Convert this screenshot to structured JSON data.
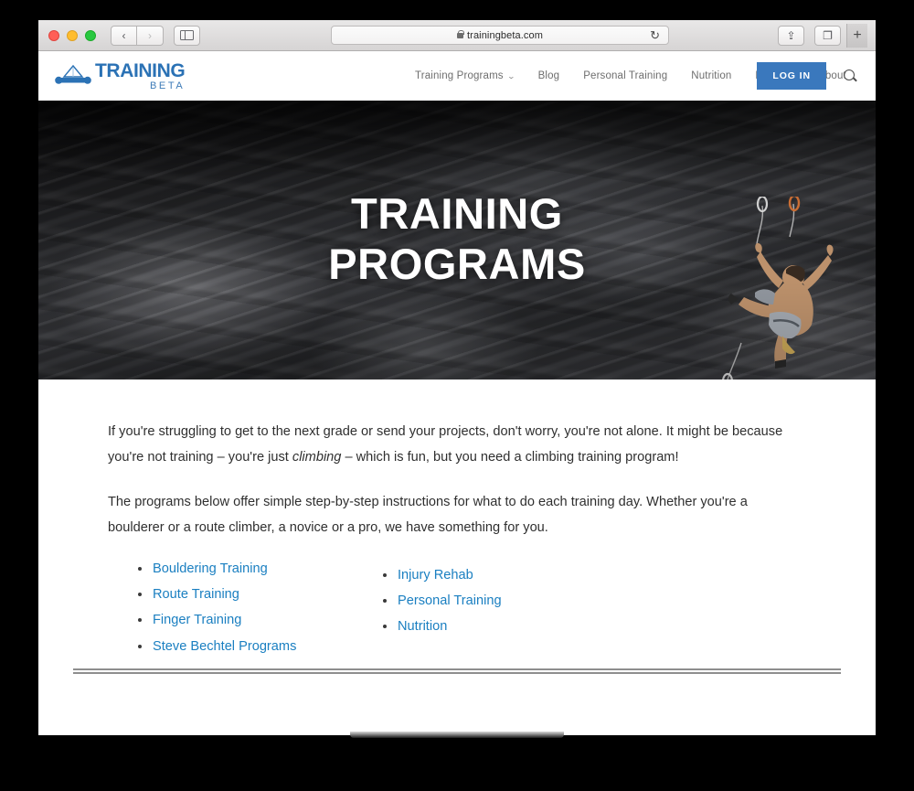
{
  "browser": {
    "url": "trainingbeta.com",
    "lock_icon": "lock-icon",
    "reload_icon": "↻",
    "back_icon": "‹",
    "forward_icon": "›",
    "sidebar_icon": "sidebar-icon",
    "share_icon": "⇪",
    "tabs_icon": "❐",
    "new_tab_icon": "+"
  },
  "site_header": {
    "logo": {
      "primary": "TRAINING",
      "secondary": "BETA",
      "mark": "climber-mountain-icon"
    },
    "nav": [
      {
        "label": "Training Programs",
        "has_dropdown": true,
        "caret": "⌄"
      },
      {
        "label": "Blog",
        "has_dropdown": false
      },
      {
        "label": "Personal Training",
        "has_dropdown": false
      },
      {
        "label": "Nutrition",
        "has_dropdown": false
      },
      {
        "label": "Podcast",
        "has_dropdown": false
      },
      {
        "label": "About",
        "has_dropdown": false
      }
    ],
    "login_label": "LOG IN",
    "login_color": "#3a78bd",
    "search_icon": "search-icon"
  },
  "hero": {
    "title_line1": "TRAINING",
    "title_line2": "PROGRAMS",
    "image_alt": "rock-climber-on-cliff"
  },
  "content": {
    "paragraph1_part1": "If you're struggling to get to the next grade or send your projects, don't worry, you're not alone. It might be because you're not training – you're just ",
    "paragraph1_italic": "climbing",
    "paragraph1_part2": " – which is fun, but you need a climbing training program!",
    "paragraph2": "The programs below offer simple step-by-step instructions for what to do each training day. Whether you're a boulderer or a route climber, a novice or a pro, we have something for you.",
    "link_color": "#1a7fc1",
    "links_left": [
      "Bouldering Training",
      "Route Training",
      "Finger Training",
      "Steve Bechtel Programs"
    ],
    "links_right": [
      "Injury Rehab",
      "Personal Training",
      "Nutrition"
    ]
  }
}
